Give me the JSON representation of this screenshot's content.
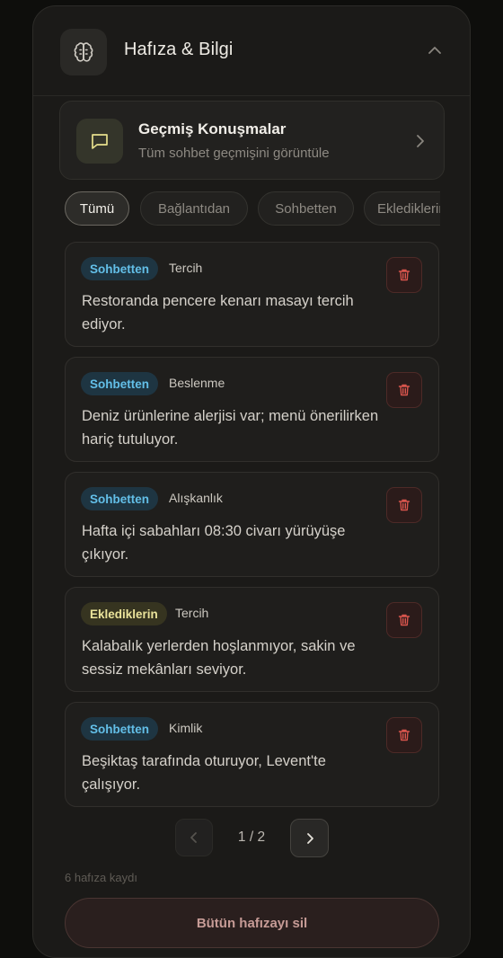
{
  "header": {
    "title": "Hafıza & Bilgi",
    "icon": "brain-icon"
  },
  "history": {
    "title": "Geçmiş Konuşmalar",
    "subtitle": "Tüm sohbet geçmişini görüntüle",
    "icon": "message-square-icon"
  },
  "filters": [
    {
      "label": "Tümü",
      "active": true
    },
    {
      "label": "Bağlantıdan",
      "active": false
    },
    {
      "label": "Sohbetten",
      "active": false
    },
    {
      "label": "Eklediklerin",
      "active": false
    }
  ],
  "memories": [
    {
      "source": "Sohbetten",
      "source_kind": "chat",
      "category": "Tercih",
      "text": "Restoranda pencere kenarı masayı tercih ediyor."
    },
    {
      "source": "Sohbetten",
      "source_kind": "chat",
      "category": "Beslenme",
      "text": "Deniz ürünlerine alerjisi var; menü önerilirken hariç tutuluyor."
    },
    {
      "source": "Sohbetten",
      "source_kind": "chat",
      "category": "Alışkanlık",
      "text": "Hafta içi sabahları 08:30 civarı yürüyüşe çıkıyor."
    },
    {
      "source": "Eklediklerin",
      "source_kind": "added",
      "category": "Tercih",
      "text": "Kalabalık yerlerden hoşlanmıyor, sakin ve sessiz mekânları seviyor."
    },
    {
      "source": "Sohbetten",
      "source_kind": "chat",
      "category": "Kimlik",
      "text": "Beşiktaş tarafında oturuyor, Levent'te çalışıyor."
    }
  ],
  "pagination": {
    "label": "1 / 2"
  },
  "count_text": "6 hafıza kaydı",
  "wipe_button": "Bütün hafızayı sil",
  "colors": {
    "chat_tag": "#63bfe8",
    "added_tag": "#eae39b",
    "delete": "#d9554d"
  }
}
